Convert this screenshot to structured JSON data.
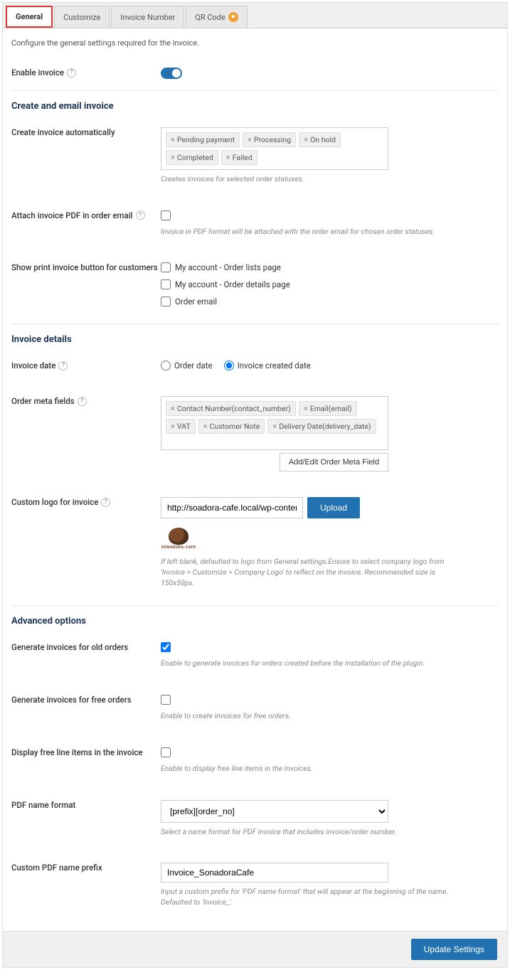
{
  "tabs": {
    "general": "General",
    "customize": "Customize",
    "invoice_number": "Invoice Number",
    "qr_code": "QR Code"
  },
  "intro": "Configure the general settings required for the invoice.",
  "enable_invoice": {
    "label": "Enable invoice"
  },
  "section_create_email": "Create and email invoice",
  "create_auto": {
    "label": "Create invoice automatically",
    "chips": [
      "Pending payment",
      "Processing",
      "On hold",
      "Completed",
      "Failed"
    ],
    "hint": "Creates invoices for selected order statuses."
  },
  "attach_pdf": {
    "label": "Attach invoice PDF in order email",
    "hint": "Invoice in PDF format will be attached with the order email for chosen order statuses."
  },
  "show_print": {
    "label": "Show print invoice button for customers",
    "opts": [
      "My account - Order lists page",
      "My account - Order details page",
      "Order email"
    ]
  },
  "section_invoice_details": "Invoice details",
  "invoice_date": {
    "label": "Invoice date",
    "order_date": "Order date",
    "created_date": "Invoice created date"
  },
  "order_meta": {
    "label": "Order meta fields",
    "chips": [
      "Contact Number(contact_number)",
      "Email(email)",
      "VAT",
      "Customer Note",
      "Delivery Date(delivery_date)"
    ],
    "btn": "Add/Edit Order Meta Field"
  },
  "custom_logo": {
    "label": "Custom logo for invoice",
    "value": "http://soadora-cafe.local/wp-content/up",
    "upload": "Upload",
    "logo_name": "SONADORA-CAFE",
    "hint": "If left blank, defaulted to logo from General settings.Ensure to select company logo from 'Invoice > Customize > Company Logo' to reflect on the invoice. Recommended size is 150x50px."
  },
  "section_advanced": "Advanced options",
  "gen_old": {
    "label": "Generate invoices for old orders",
    "hint": "Enable to generate invoices for orders created before the installation of the plugin."
  },
  "gen_free": {
    "label": "Generate invoices for free orders",
    "hint": "Enable to create invoices for free orders."
  },
  "display_free": {
    "label": "Display free line items in the invoice",
    "hint": "Enable to display free line items in the invoices."
  },
  "pdf_format": {
    "label": "PDF name format",
    "value": "[prefix][order_no]",
    "hint": "Select a name format for PDF invoice that includes invoice/order number."
  },
  "pdf_prefix": {
    "label": "Custom PDF name prefix",
    "value": "Invoice_SonadoraCafe",
    "hint": "Input a custom prefix for 'PDF name format' that will appear at the beginning of the name. Defaulted to 'Invoice_'."
  },
  "footer": {
    "update": "Update Settings"
  }
}
